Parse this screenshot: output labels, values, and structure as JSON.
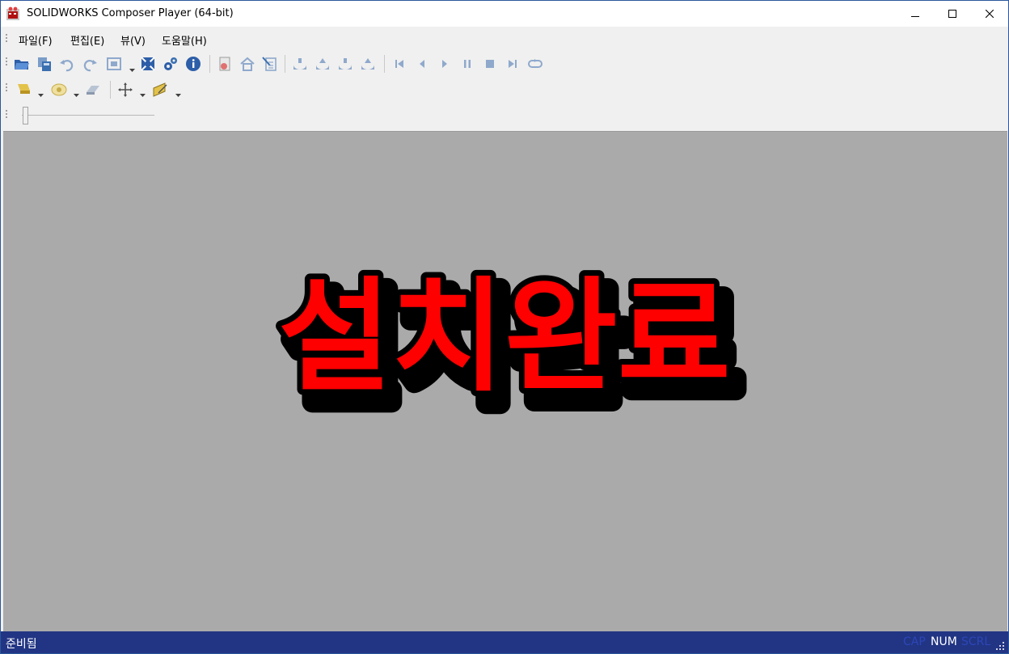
{
  "window": {
    "title": "SOLIDWORKS Composer Player (64-bit)"
  },
  "colors": {
    "titlebar_bg": "#ffffff",
    "chrome_bg": "#f0f0f0",
    "viewport_bg": "#aaaaaa",
    "statusbar_bg": "#223584",
    "overlay_fill": "#ff0000",
    "overlay_outline": "#000000",
    "icon_blue": "#3a6fb0"
  },
  "menu": [
    {
      "label": "파일(F)"
    },
    {
      "label": "편집(E)"
    },
    {
      "label": "뷰(V)"
    },
    {
      "label": "도움말(H)"
    }
  ],
  "toolbar1": [
    "open-folder-icon",
    "save-copy-icon",
    "undo-icon",
    "redo-icon",
    "zoom-fit-icon",
    "grid-icon",
    "settings-gears-icon",
    "info-icon",
    "render-icon",
    "home-view-icon",
    "properties-icon",
    "camera-1-icon",
    "camera-2-icon",
    "camera-3-icon",
    "camera-4-icon",
    "first-frame-icon",
    "previous-icon",
    "play-icon",
    "pause-icon",
    "stop-icon",
    "last-frame-icon",
    "loop-icon"
  ],
  "toolbar2": [
    "light-icon",
    "eye-view-icon",
    "eraser-icon",
    "move-icon",
    "plane-icon"
  ],
  "slider": {
    "value": 0
  },
  "viewport": {
    "overlay_text": "설치완료"
  },
  "status": {
    "text": "준비됨",
    "indicators": [
      "CAP",
      "NUM",
      "SCRL"
    ],
    "active": [
      false,
      true,
      false
    ]
  }
}
